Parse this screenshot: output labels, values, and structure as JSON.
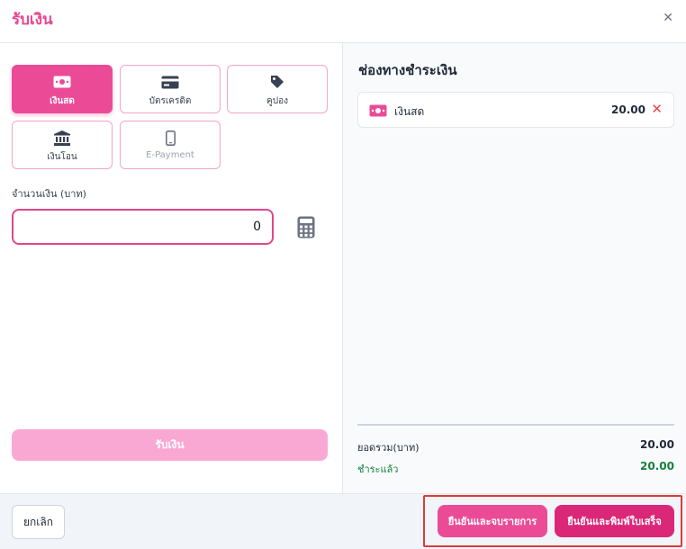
{
  "header": {
    "title": "รับเงิน",
    "close_icon": "close-icon"
  },
  "methods": [
    {
      "label": "เงินสด",
      "icon": "cash-icon",
      "active": true
    },
    {
      "label": "บัตรเครดิต",
      "icon": "credit-card-icon"
    },
    {
      "label": "คูปอง",
      "icon": "coupon-tag-icon"
    },
    {
      "label": "เงินโอน",
      "icon": "bank-icon"
    },
    {
      "label": "E-Payment",
      "icon": "mobile-phone-icon",
      "disabled": true
    }
  ],
  "amount": {
    "label": "จำนวนเงิน (บาท)",
    "value": "0",
    "calculator_icon": "calculator-icon"
  },
  "receive_button": "รับเงิน",
  "channels": {
    "title": "ช่องทางชำระเงิน",
    "items": [
      {
        "name": "เงินสด",
        "amount": "20.00",
        "icon": "cash-icon",
        "remove_icon": "remove-icon"
      }
    ]
  },
  "summary": {
    "total_label": "ยอดรวม(บาท)",
    "total_value": "20.00",
    "paid_label": "ชำระแล้ว",
    "paid_value": "20.00"
  },
  "footer": {
    "cancel": "ยกเลิก",
    "confirm_close": "ยืนยันและจบรายการ",
    "confirm_print": "ยืนยันและพิมพ์ใบเสร็จ"
  },
  "colors": {
    "brand": "#eb4b96",
    "brand_dark": "#db2777",
    "brand_light": "#f9a8d4",
    "paid_text": "#15803d",
    "remove": "#ef4444",
    "highlight": "#dc3a3a"
  }
}
